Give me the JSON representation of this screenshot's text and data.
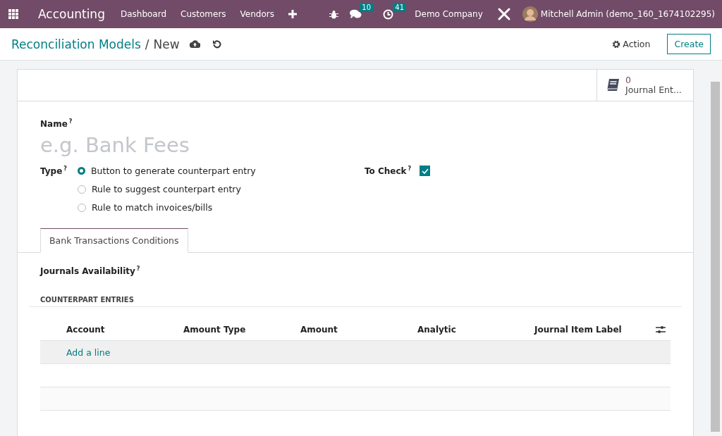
{
  "navbar": {
    "app_name": "Accounting",
    "menu": [
      "Dashboard",
      "Customers",
      "Vendors"
    ],
    "messages_count": "10",
    "activities_count": "41",
    "company": "Demo Company",
    "user": "Mitchell Admin (demo_160_1674102295)"
  },
  "control_panel": {
    "breadcrumb": [
      "Reconciliation Models",
      "New"
    ],
    "separator": "/",
    "action": "Action",
    "create": "Create"
  },
  "smart_button": {
    "count": "0",
    "label": "Journal Ent..."
  },
  "form": {
    "name_label": "Name",
    "name_help": "?",
    "name_placeholder": "e.g. Bank Fees",
    "type_label": "Type",
    "type_help": "?",
    "type_options": [
      {
        "label": "Button to generate counterpart entry",
        "selected": true
      },
      {
        "label": "Rule to suggest counterpart entry",
        "selected": false
      },
      {
        "label": "Rule to match invoices/bills",
        "selected": false
      }
    ],
    "to_check_label": "To Check",
    "to_check_help": "?",
    "to_check": true
  },
  "tabs": [
    {
      "label": "Bank Transactions Conditions",
      "selected": true
    }
  ],
  "journals_label": "Journals Availability",
  "journals_help": "?",
  "section_title": "COUNTERPART ENTRIES",
  "table": {
    "columns": [
      "Account",
      "Amount Type",
      "Amount",
      "Analytic",
      "Journal Item Label"
    ],
    "add_line": "Add a line"
  }
}
